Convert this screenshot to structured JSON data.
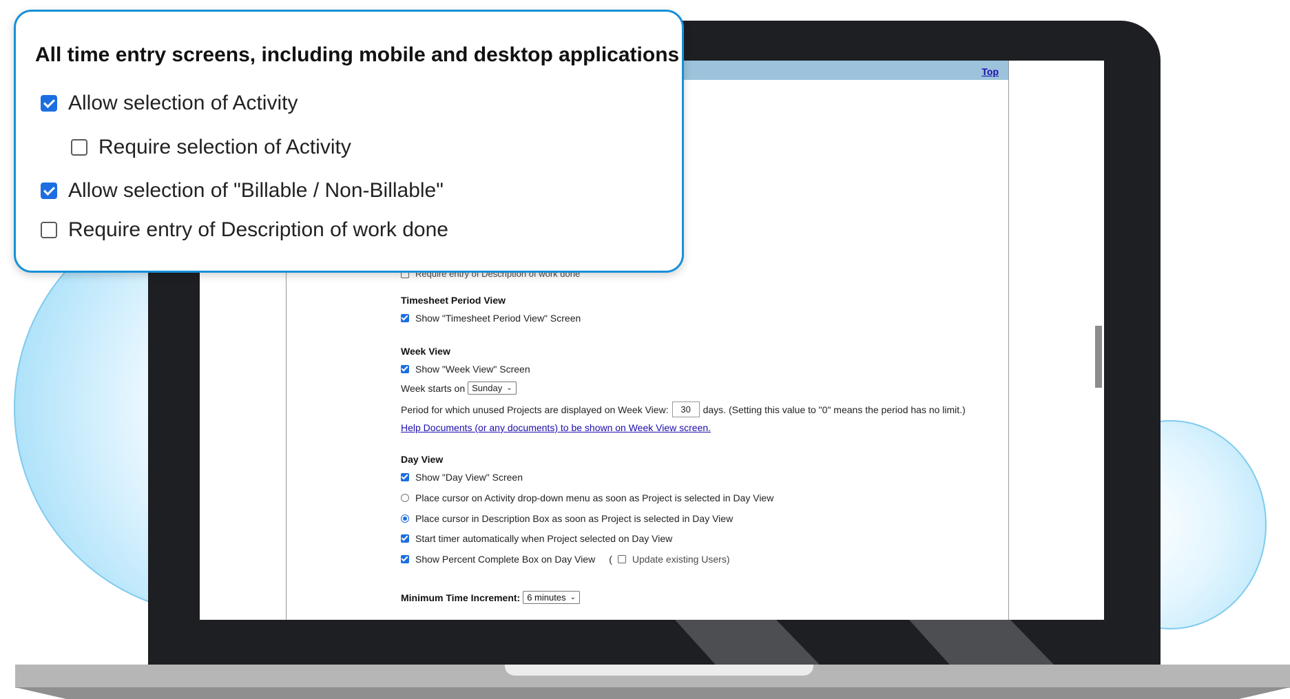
{
  "page": {
    "top_link": "Top"
  },
  "callout": {
    "title": "All time entry screens, including mobile and desktop applications",
    "items": [
      {
        "label": "Allow selection of Activity",
        "checked": true
      },
      {
        "label": "Require selection of Activity",
        "checked": false
      },
      {
        "label": "Allow selection of \"Billable / Non-Billable\"",
        "checked": true
      },
      {
        "label": "Require entry of Description of work done",
        "checked": false
      }
    ]
  },
  "settings": {
    "partial_row": "Require entry of Description of work done",
    "timesheet": {
      "heading": "Timesheet Period View",
      "show_label": "Show \"Timesheet Period View\" Screen",
      "show_checked": true
    },
    "week": {
      "heading": "Week View",
      "show_label": "Show \"Week View\" Screen",
      "show_checked": true,
      "starts_label": "Week starts on",
      "starts_value": "Sunday",
      "period_label": "Period for which unused Projects are displayed on Week View:",
      "period_value": "30",
      "period_suffix": "days. (Setting this value to \"0\" means the period has no limit.)",
      "help_link": "Help Documents (or any documents) to be shown on Week View screen."
    },
    "day": {
      "heading": "Day View",
      "show_label": "Show \"Day View\" Screen",
      "show_checked": true,
      "radio_activity": "Place cursor on Activity drop-down menu as soon as Project is selected in Day View",
      "radio_activity_selected": false,
      "radio_description": "Place cursor in Description Box as soon as Project is selected in Day View",
      "radio_description_selected": true,
      "timer_label": "Start timer automatically when Project selected on Day View",
      "timer_checked": true,
      "percent_label": "Show Percent Complete Box on Day View",
      "percent_checked": true,
      "paren_open": "(",
      "update_label": "Update existing Users)",
      "update_checked": false
    },
    "min_increment": {
      "label": "Minimum Time Increment:",
      "value": "6 minutes"
    }
  }
}
